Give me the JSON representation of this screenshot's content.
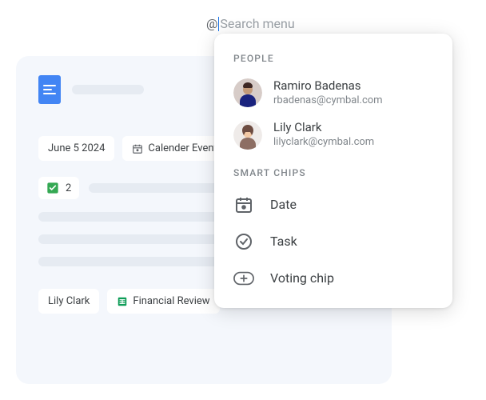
{
  "search": {
    "at": "@",
    "placeholder": "Search menu"
  },
  "doc": {
    "chip_date": "June 5 2024",
    "chip_calendar": "Calender Event",
    "chip_check_count": "2",
    "chip_person": "Lily Clark",
    "chip_sheet": "Financial Review"
  },
  "menu": {
    "sections": {
      "people": "PEOPLE",
      "smart_chips": "SMART CHIPS"
    },
    "people": [
      {
        "name": "Ramiro Badenas",
        "email": "rbadenas@cymbal.com"
      },
      {
        "name": "Lily Clark",
        "email": "lilyclark@cymbal.com"
      }
    ],
    "chips": {
      "date": "Date",
      "task": "Task",
      "voting": "Voting chip"
    }
  }
}
